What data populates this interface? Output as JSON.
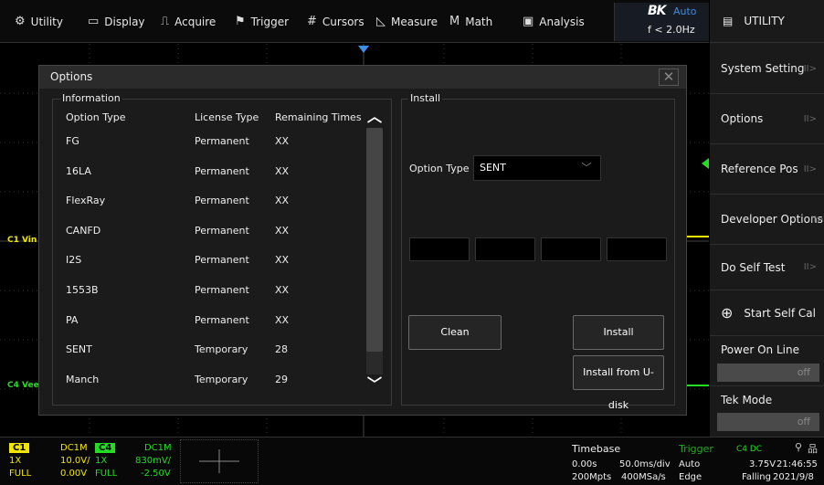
{
  "menu": {
    "items": [
      {
        "label": "Utility",
        "icon": "gear-icon",
        "glyph": "⚙"
      },
      {
        "label": "Display",
        "icon": "monitor-icon",
        "glyph": "▭"
      },
      {
        "label": "Acquire",
        "icon": "acquire-icon",
        "glyph": "⎍"
      },
      {
        "label": "Trigger",
        "icon": "flag-icon",
        "glyph": "⚑"
      },
      {
        "label": "Cursors",
        "icon": "cursors-icon",
        "glyph": "#"
      },
      {
        "label": "Measure",
        "icon": "measure-icon",
        "glyph": "◺"
      },
      {
        "label": "Math",
        "icon": "math-icon",
        "glyph": "M"
      },
      {
        "label": "Analysis",
        "icon": "analysis-icon",
        "glyph": "▣"
      }
    ]
  },
  "brand": {
    "logo": "BK",
    "mode": "Auto",
    "freq": "f < 2.0Hz"
  },
  "right_panel": {
    "header_icon": "document-icon",
    "title": "UTILITY",
    "items": [
      {
        "label": "System Setting",
        "arrow": "II>"
      },
      {
        "label": "Options",
        "arrow": "II>"
      },
      {
        "label": "Reference Pos",
        "arrow": "II>"
      },
      {
        "label": "Developer Options",
        "arrow": "II>"
      },
      {
        "label": "Do Self Test",
        "arrow": "II>"
      },
      {
        "label": "Start Self Cal",
        "arrow": ""
      }
    ],
    "power_on_line": {
      "label": "Power On Line",
      "value": "off"
    },
    "tek_mode": {
      "label": "Tek Mode",
      "value": "off"
    }
  },
  "scope": {
    "ch1_marker": "C1 Vin",
    "ch4_marker": "C4 Vee"
  },
  "dialog": {
    "title": "Options",
    "close": "✕",
    "information": {
      "label": "Information",
      "columns": [
        "Option Type",
        "License Type",
        "Remaining Times"
      ],
      "rows": [
        [
          "FG",
          "Permanent",
          "XX"
        ],
        [
          "16LA",
          "Permanent",
          "XX"
        ],
        [
          "FlexRay",
          "Permanent",
          "XX"
        ],
        [
          "CANFD",
          "Permanent",
          "XX"
        ],
        [
          "I2S",
          "Permanent",
          "XX"
        ],
        [
          "1553B",
          "Permanent",
          "XX"
        ],
        [
          "PA",
          "Permanent",
          "XX"
        ],
        [
          "SENT",
          "Temporary",
          "28"
        ],
        [
          "Manch",
          "Temporary",
          "29"
        ]
      ],
      "scroll_up": "︿",
      "scroll_down": "﹀"
    },
    "install": {
      "label": "Install",
      "option_type_label": "Option Type",
      "option_type_value": "SENT",
      "clean_label": "Clean",
      "install_label": "Install",
      "install_udisk_label": "Install from U-disk"
    }
  },
  "status": {
    "ch1": {
      "tag": "C1",
      "coupling": "DC1M",
      "probe": "1X",
      "scale": "10.0V/",
      "bw": "FULL",
      "offset": "0.00V"
    },
    "ch4": {
      "tag": "C4",
      "coupling": "DC1M",
      "probe": "1X",
      "scale": "830mV/",
      "bw": "FULL",
      "offset": "-2.50V"
    },
    "timebase": {
      "label": "Timebase",
      "delay": "0.00s",
      "scale": "50.0ms/div",
      "points": "200Mpts",
      "rate": "400MSa/s"
    },
    "trigger": {
      "label": "Trigger",
      "mode": "Auto",
      "type": "Edge",
      "source": "C4 DC",
      "level": "3.75V",
      "slope": "Falling"
    },
    "clock": {
      "time": "21:46:55",
      "date": "2021/9/8",
      "usb_icon": "usb-icon",
      "network_icon": "network-icon"
    }
  },
  "colors": {
    "ch1": "#f2e600",
    "ch4": "#22dd22",
    "accent": "#3d8ee8",
    "trigger": "#22aa22"
  }
}
